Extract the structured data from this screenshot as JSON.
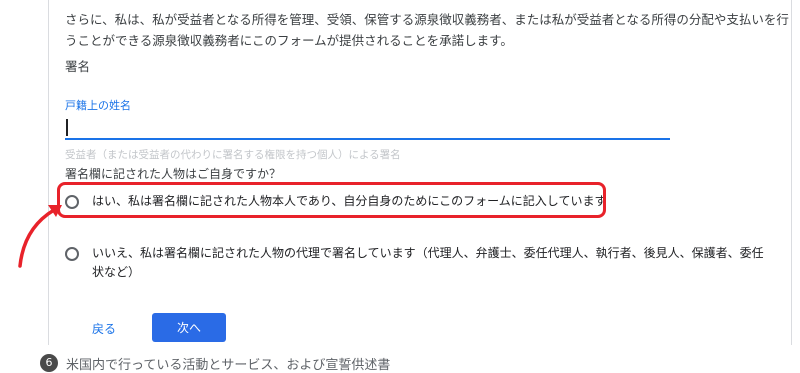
{
  "form": {
    "consent_text": "さらに、私は、私が受益者となる所得を管理、受領、保管する源泉徴収義務者、または私が受益者となる所得の分配や支払いを行うことができる源泉徴収義務者にこのフォームが提供されることを承諾します。",
    "signature_heading": "署名",
    "name_field": {
      "label": "戸籍上の姓名",
      "value": "",
      "helper": "受益者（または受益者の代わりに署名する権限を持つ個人）による署名"
    },
    "question": "署名欄に記された人物はご自身ですか？",
    "options": [
      {
        "label": "はい、私は署名欄に記された人物本人であり、自分自身のためにこのフォームに記入しています",
        "highlighted": true
      },
      {
        "label": "いいえ、私は署名欄に記された人物の代理で署名しています（代理人、弁護士、委任代理人、執行者、後見人、保護者、委任状など）",
        "highlighted": false
      }
    ],
    "back_label": "戻る",
    "next_label": "次へ"
  },
  "next_section": {
    "number": "6",
    "title": "米国内で行っている活動とサービス、および宣誓供述書"
  },
  "colors": {
    "accent": "#1a73e8",
    "button": "#2a6be6",
    "annotation": "#e8222a"
  },
  "icons": {
    "arrow": "curved-arrow-icon"
  }
}
